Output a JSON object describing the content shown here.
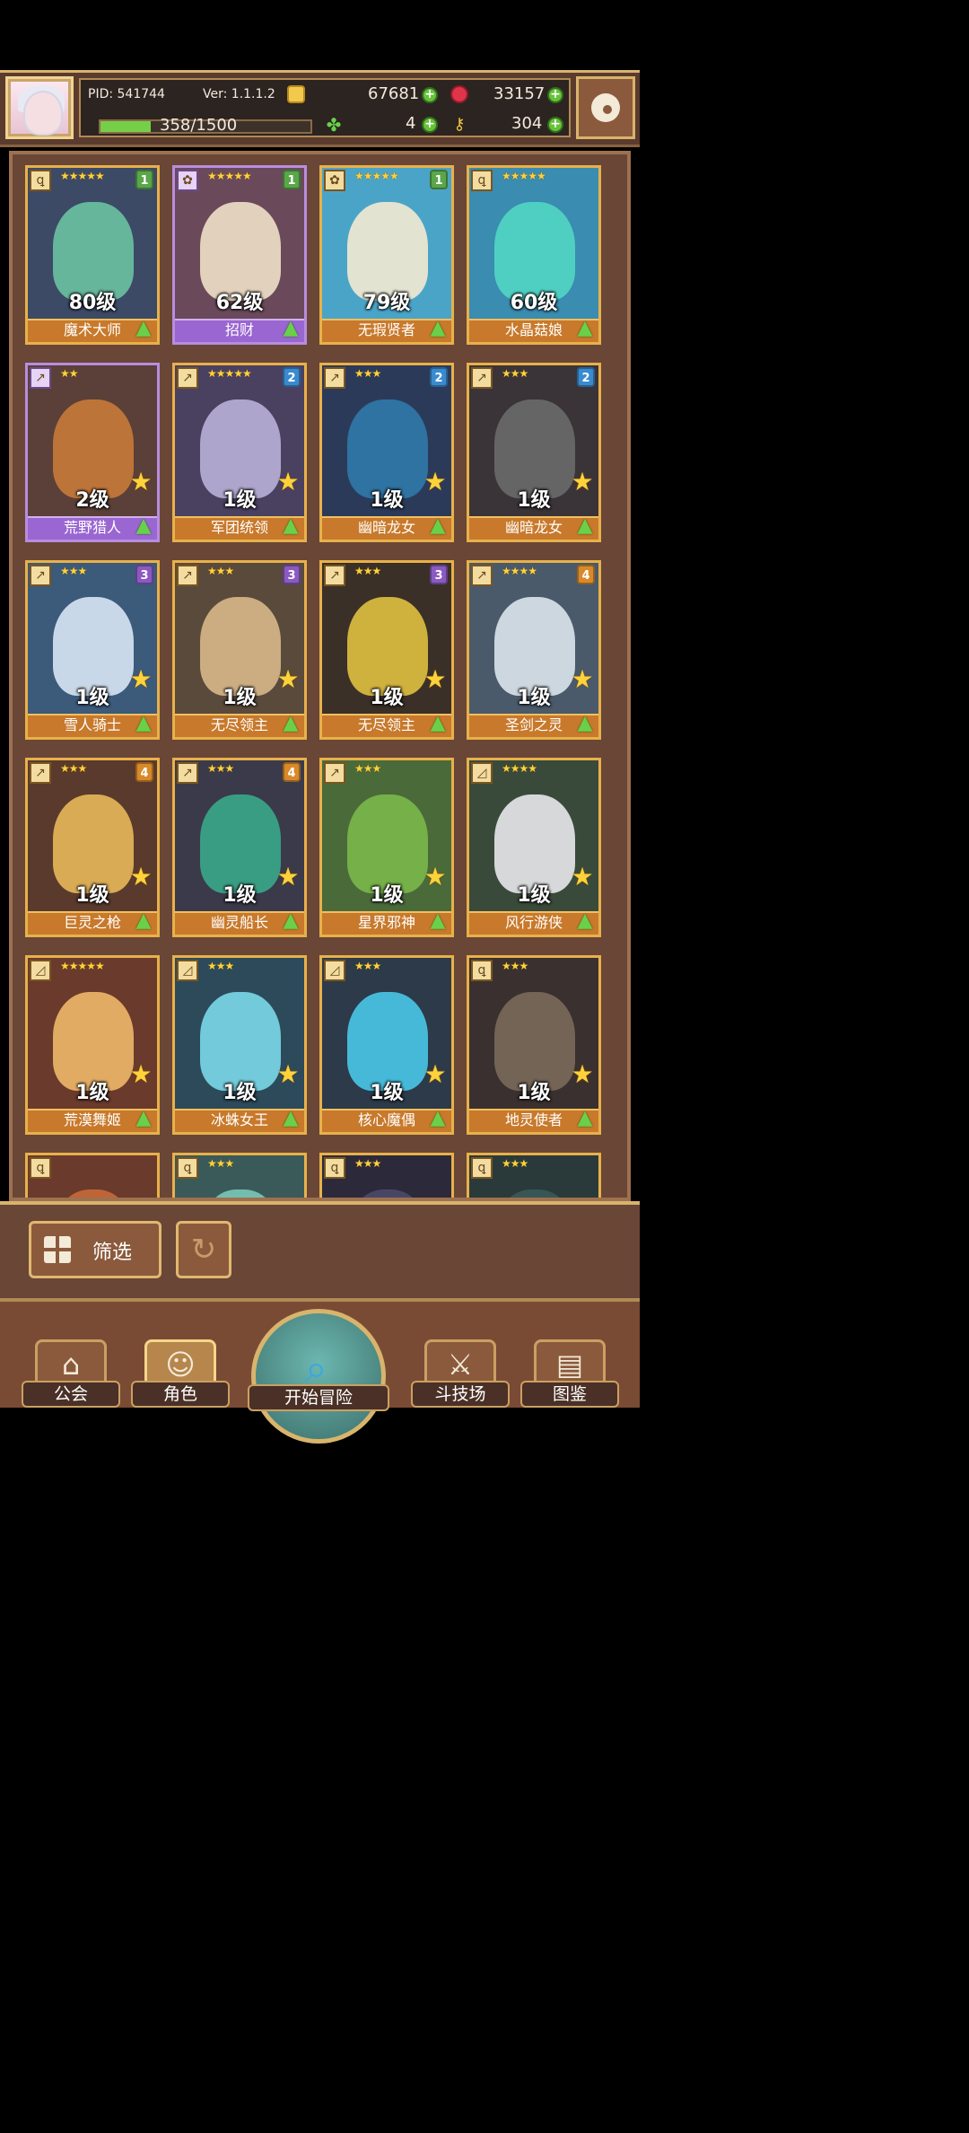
{
  "header": {
    "pid": "PID: 541744",
    "version": "Ver: 1.1.1.2",
    "gold": "67681",
    "gems": "33157",
    "clover_count": "4",
    "key_count": "304",
    "exp_text": "358/1500",
    "exp_fraction": 0.24
  },
  "roster": [
    {
      "level": "80级",
      "name": "魔术大师",
      "stars": "★★★★★",
      "badge": "1",
      "badge_color": "#5aa64a",
      "frame": "gold",
      "bg": "#3c4a66",
      "portrait": "#6ac2a2",
      "cls": "ꝗ",
      "up": true,
      "star": false
    },
    {
      "level": "62级",
      "name": "招财",
      "stars": "★★★★★",
      "badge": "1",
      "badge_color": "#5aa64a",
      "frame": "purple",
      "bg": "#6a4a5a",
      "portrait": "#efe0c8",
      "cls": "✿",
      "up": true,
      "star": false
    },
    {
      "level": "79级",
      "name": "无瑕贤者",
      "stars": "★★★★★",
      "badge": "1",
      "badge_color": "#5aa64a",
      "frame": "gold",
      "bg": "#4aa4c8",
      "portrait": "#f3ead0",
      "cls": "✿",
      "up": true,
      "star": false
    },
    {
      "level": "60级",
      "name": "水晶菇娘",
      "stars": "★★★★★",
      "badge": "",
      "badge_color": "",
      "frame": "gold",
      "bg": "#3a8cb0",
      "portrait": "#52d6c4",
      "cls": "ꝗ",
      "up": true,
      "star": false
    },
    {
      "level": "2级",
      "name": "荒野猎人",
      "stars": "★★",
      "badge": "",
      "badge_color": "",
      "frame": "purple",
      "bg": "#5a4038",
      "portrait": "#c87a3a",
      "cls": "↗",
      "up": true,
      "star": true
    },
    {
      "level": "1级",
      "name": "军团统领",
      "stars": "★★★★★",
      "badge": "2",
      "badge_color": "#3a8ad0",
      "frame": "gold",
      "bg": "#4a4060",
      "portrait": "#b8b0d8",
      "cls": "↗",
      "up": true,
      "star": true
    },
    {
      "level": "1级",
      "name": "幽暗龙女",
      "stars": "★★★",
      "badge": "2",
      "badge_color": "#3a8ad0",
      "frame": "gold",
      "bg": "#2c3a5a",
      "portrait": "#2f7aa8",
      "cls": "↗",
      "up": true,
      "star": true
    },
    {
      "level": "1级",
      "name": "幽暗龙女",
      "stars": "★★★",
      "badge": "2",
      "badge_color": "#3a8ad0",
      "frame": "gold",
      "bg": "#3a3438",
      "portrait": "#6a6a6a",
      "cls": "↗",
      "up": true,
      "star": true
    },
    {
      "level": "1级",
      "name": "雪人骑士",
      "stars": "★★★",
      "badge": "3",
      "badge_color": "#8a5ac0",
      "frame": "gold",
      "bg": "#3c5a7a",
      "portrait": "#d8e6f4",
      "cls": "↗",
      "up": true,
      "star": true
    },
    {
      "level": "1级",
      "name": "无尽领主",
      "stars": "★★★",
      "badge": "3",
      "badge_color": "#8a5ac0",
      "frame": "gold",
      "bg": "#5a4a3c",
      "portrait": "#d8b88a",
      "cls": "↗",
      "up": true,
      "star": true
    },
    {
      "level": "1级",
      "name": "无尽领主",
      "stars": "★★★",
      "badge": "3",
      "badge_color": "#8a5ac0",
      "frame": "gold",
      "bg": "#3a3028",
      "portrait": "#e0c040",
      "cls": "↗",
      "up": true,
      "star": true
    },
    {
      "level": "1级",
      "name": "圣剑之灵",
      "stars": "★★★★",
      "badge": "4",
      "badge_color": "#d88a2a",
      "frame": "gold",
      "bg": "#4a5a6a",
      "portrait": "#dce4ec",
      "cls": "↗",
      "up": true,
      "star": true
    },
    {
      "level": "1级",
      "name": "巨灵之枪",
      "stars": "★★★",
      "badge": "4",
      "badge_color": "#d88a2a",
      "frame": "gold",
      "bg": "#5a3a2c",
      "portrait": "#e8b85a",
      "cls": "↗",
      "up": true,
      "star": true
    },
    {
      "level": "1级",
      "name": "幽灵船长",
      "stars": "★★★",
      "badge": "4",
      "badge_color": "#d88a2a",
      "frame": "gold",
      "bg": "#3a3a4a",
      "portrait": "#3aa88a",
      "cls": "↗",
      "up": true,
      "star": true
    },
    {
      "level": "1级",
      "name": "星界邪神",
      "stars": "★★★",
      "badge": "",
      "badge_color": "",
      "frame": "gold",
      "bg": "#4a6a3a",
      "portrait": "#7ab84a",
      "cls": "↗",
      "up": true,
      "star": true
    },
    {
      "level": "1级",
      "name": "风行游侠",
      "stars": "★★★★",
      "badge": "",
      "badge_color": "",
      "frame": "gold",
      "bg": "#3a4a3a",
      "portrait": "#e8e8ec",
      "cls": "◿",
      "up": true,
      "star": true
    },
    {
      "level": "1级",
      "name": "荒漠舞姬",
      "stars": "★★★★★",
      "badge": "",
      "badge_color": "",
      "frame": "gold",
      "bg": "#6a3a2c",
      "portrait": "#f0b86a",
      "cls": "◿",
      "up": true,
      "star": true
    },
    {
      "level": "1级",
      "name": "冰蛛女王",
      "stars": "★★★",
      "badge": "",
      "badge_color": "",
      "frame": "gold",
      "bg": "#2c4a5a",
      "portrait": "#7ad8e8",
      "cls": "◿",
      "up": true,
      "star": true
    },
    {
      "level": "1级",
      "name": "核心魔偶",
      "stars": "★★★",
      "badge": "",
      "badge_color": "",
      "frame": "gold",
      "bg": "#2c3a4a",
      "portrait": "#4ac8e8",
      "cls": "◿",
      "up": true,
      "star": true
    },
    {
      "level": "1级",
      "name": "地灵使者",
      "stars": "★★★",
      "badge": "",
      "badge_color": "",
      "frame": "gold",
      "bg": "#3a3030",
      "portrait": "#7a6a5a",
      "cls": "ꝗ",
      "up": true,
      "star": true
    },
    {
      "level": "",
      "name": "",
      "stars": "",
      "badge": "",
      "badge_color": "",
      "frame": "gold",
      "bg": "#6a3a2c",
      "portrait": "#c86a3a",
      "cls": "ꝗ",
      "up": false,
      "star": false
    },
    {
      "level": "",
      "name": "",
      "stars": "★★★",
      "badge": "",
      "badge_color": "",
      "frame": "gold",
      "bg": "#3a5a5a",
      "portrait": "#7ac8b8",
      "cls": "ꝗ",
      "up": false,
      "star": false
    },
    {
      "level": "",
      "name": "",
      "stars": "★★★",
      "badge": "",
      "badge_color": "",
      "frame": "gold",
      "bg": "#2c2a3a",
      "portrait": "#4a4a6a",
      "cls": "ꝗ",
      "up": false,
      "star": false
    },
    {
      "level": "",
      "name": "",
      "stars": "★★★",
      "badge": "",
      "badge_color": "",
      "frame": "gold",
      "bg": "#2a3a3a",
      "portrait": "#3a5a5a",
      "cls": "ꝗ",
      "up": false,
      "star": false
    }
  ],
  "controls": {
    "filter_label": "筛选",
    "reset_icon": "refresh-icon"
  },
  "nav": {
    "guild": "公会",
    "character": "角色",
    "adventure": "开始冒险",
    "arena": "斗技场",
    "codex": "图鉴"
  }
}
